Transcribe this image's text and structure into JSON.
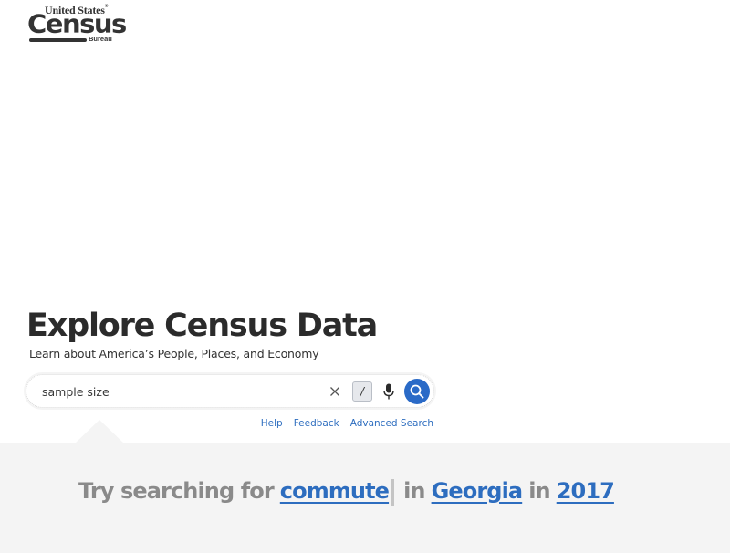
{
  "logo": {
    "line1": "United States",
    "registered": "®",
    "line2": "Census",
    "line3": "Bureau"
  },
  "hero": {
    "title": "Explore Census Data",
    "subtitle": "Learn about America’s People, Places, and Economy"
  },
  "search": {
    "value": "sample size",
    "placeholder": "",
    "shortcut_key": "/",
    "icons": {
      "clear": "close-icon",
      "mic": "microphone-icon",
      "submit": "search-icon"
    }
  },
  "links": [
    {
      "label": "Help"
    },
    {
      "label": "Feedback"
    },
    {
      "label": "Advanced Search"
    }
  ],
  "suggestion": {
    "prefix": "Try searching for",
    "topic": "commute",
    "in1": "in",
    "place": "Georgia",
    "in2": "in",
    "year": "2017"
  },
  "colors": {
    "accent": "#2a6ac7",
    "link": "#2d6dbf",
    "band": "#f4f4f4",
    "title": "#2b2b2b",
    "muted": "#8a8a8a"
  }
}
